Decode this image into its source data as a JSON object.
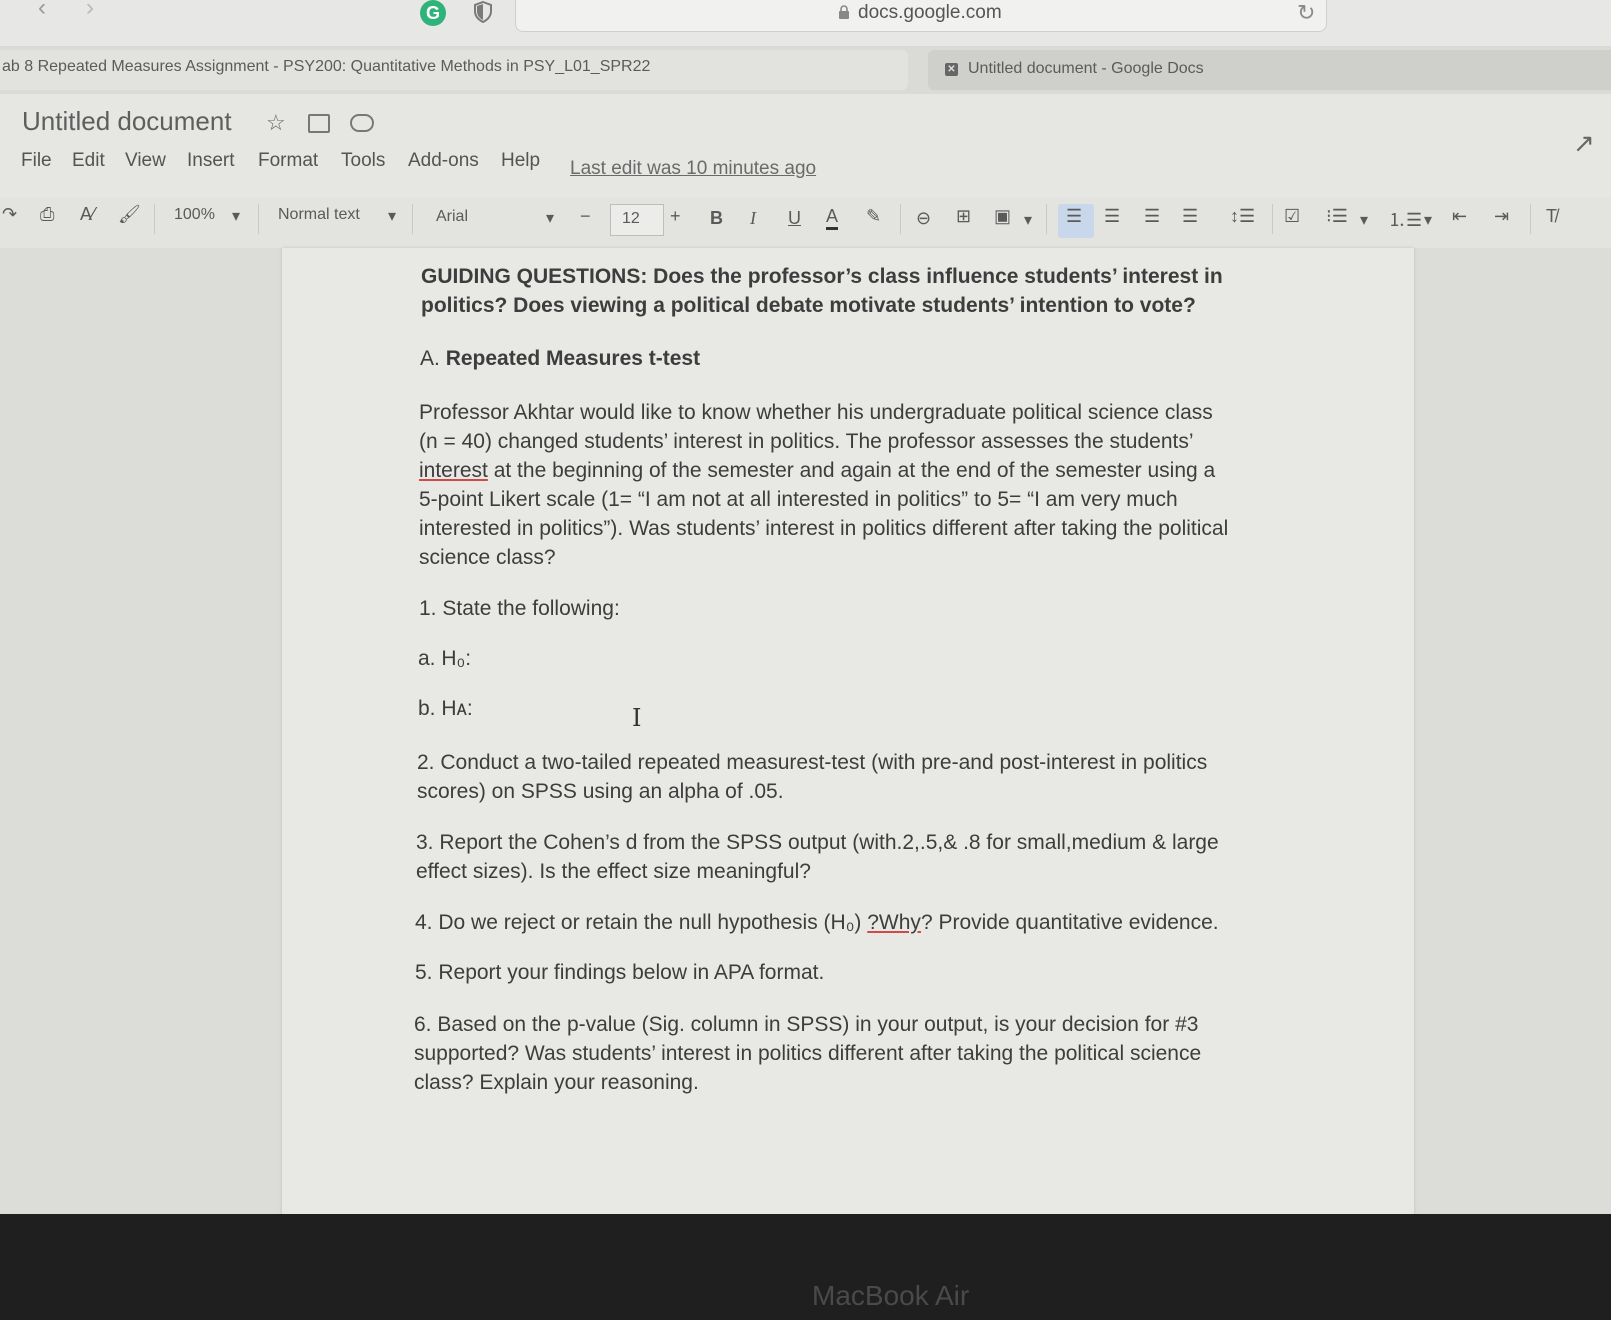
{
  "browser": {
    "url": "docs.google.com",
    "grammarly_letter": "G",
    "tabs": [
      {
        "label": "ab 8 Repeated Measures Assignment - PSY200: Quantitative Methods in PSY_L01_SPR22"
      },
      {
        "label": "Untitled document - Google Docs"
      }
    ]
  },
  "docs": {
    "title": "Untitled document",
    "menu": [
      "File",
      "Edit",
      "View",
      "Insert",
      "Format",
      "Tools",
      "Add-ons",
      "Help"
    ],
    "last_edit": "Last edit was 10 minutes ago",
    "toolbar": {
      "zoom": "100%",
      "style": "Normal text",
      "font": "Arial",
      "font_size": "12",
      "minus": "−",
      "plus": "+",
      "bold": "B",
      "italic": "I",
      "underline": "U",
      "text_color": "A"
    }
  },
  "content": {
    "guiding": "GUIDING QUESTIONS: Does the professor’s class influence students’ interest in politics? Does viewing a political debate motivate students’ intention to vote?",
    "section_letter": "A.",
    "section_title": "Repeated Measures t-test",
    "intro_p1": "Professor Akhtar would like to know whether his undergraduate political science class",
    "intro_p2": "(n = 40) changed students’ interest in politics. The professor assesses the students’",
    "intro_p3a": "interest",
    "intro_p3b": " at the beginning of the semester and again at the end of the semester using a",
    "intro_p4": "5-point Likert scale (1= “I am not at all interested in politics” to 5= “I am very much",
    "intro_p5": "interested in politics”). Was students’ interest in politics different after taking the political",
    "intro_p6": "science class?",
    "q1": "1. State the following:",
    "h0": "a. H₀:",
    "ha": "b. Hᴀ:",
    "q2a": "2. Conduct a two-tailed repeated measurest-test (with pre-and post-interest in politics",
    "q2b": "scores) on SPSS using an alpha of .05.",
    "q3a": "3. Report the Cohen’s d from the SPSS output (with.2,.5,& .8 for small,medium & large",
    "q3b": "effect sizes). Is the effect size meaningful?",
    "q4a": "4. Do we reject or retain the null hypothesis (H₀) ",
    "q4b": "?Why",
    "q4c": "? Provide quantitative evidence.",
    "q5": "5. Report your findings below in APA format.",
    "q6a": "6. Based on the p-value (Sig. column in SPSS) in your output, is your decision for #3",
    "q6b": "supported? Was students’ interest in politics different after taking the political science",
    "q6c": "class? Explain your reasoning."
  },
  "device": {
    "label": "MacBook Air"
  }
}
